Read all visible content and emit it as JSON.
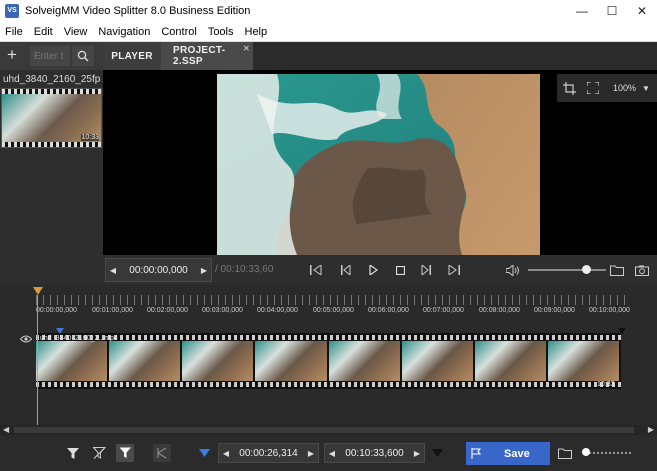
{
  "window": {
    "app_icon": "VS",
    "title": "SolveigMM Video Splitter 8.0 Business Edition",
    "minimize": "—",
    "maximize": "☐",
    "close": "✕"
  },
  "menu": [
    "File",
    "Edit",
    "View",
    "Navigation",
    "Control",
    "Tools",
    "Help"
  ],
  "left_panel": {
    "add_label": "+",
    "search_placeholder": "Enter t",
    "media_item": {
      "name": "uhd_3840_2160_25fp...",
      "duration": "10:33"
    }
  },
  "tabs": [
    {
      "label": "PLAYER",
      "active": false
    },
    {
      "label": "PROJECT-2.SSP",
      "active": true,
      "close": "✕"
    }
  ],
  "player": {
    "zoom": "100%",
    "zoom_arrow": "▼"
  },
  "transport": {
    "prev_arrow": "◀",
    "next_arrow": "▶",
    "current_time": "00:00:00,000",
    "total_time": "/ 00:10:33,60",
    "volume_level": 0.75
  },
  "timeline": {
    "ruler_labels": [
      "00:00:00,000",
      "00:01:00,000",
      "00:02:00,000",
      "00:03:00,000",
      "00:04:00,000",
      "00:05:00,000",
      "00:06:00,000",
      "00:07:00,000",
      "00:08:00,000",
      "00:09:00,000",
      "00:10:00,000"
    ],
    "track_name": "uhd_3840_2160_2...mp4",
    "track_duration": "10:33",
    "scroll_left": "◀",
    "scroll_right": "▶"
  },
  "bottom_bar": {
    "start_time": "00:00:26,314",
    "end_time": "00:10:33,600",
    "start_prev": "◀",
    "start_next": "▶",
    "end_prev": "◀",
    "end_next": "▶",
    "save_label": "Save",
    "accent_color": "#3967c9"
  }
}
